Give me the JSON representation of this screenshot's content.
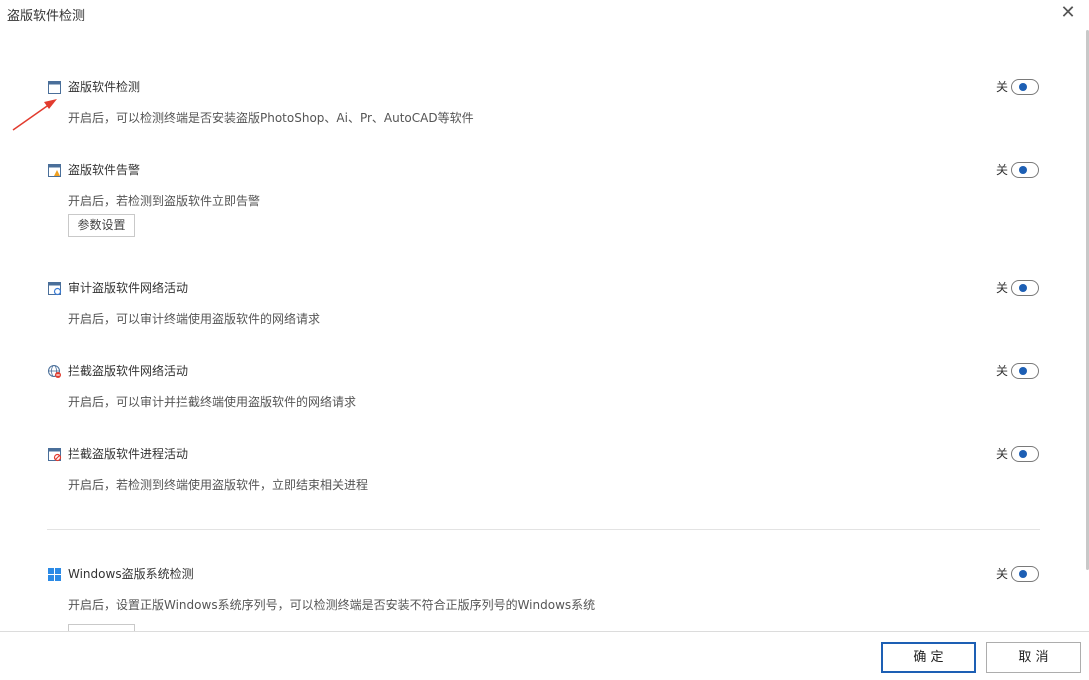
{
  "dialog": {
    "title": "盗版软件检测",
    "close_glyph": "✕"
  },
  "toggle_off_label": "关",
  "sections": [
    {
      "title": "盗版软件检测",
      "desc": "开启后，可以检测终端是否安装盗版PhotoShop、Ai、Pr、AutoCAD等软件",
      "icon": "window-icon",
      "enabled": false
    },
    {
      "title": "盗版软件告警",
      "desc": "开启后，若检测到盗版软件立即告警",
      "icon": "window-alert-icon",
      "enabled": false,
      "button_label": "参数设置"
    },
    {
      "title": "审计盗版软件网络活动",
      "desc": "开启后，可以审计终端使用盗版软件的网络请求",
      "icon": "window-audit-icon",
      "enabled": false
    },
    {
      "title": "拦截盗版软件网络活动",
      "desc": "开启后，可以审计并拦截终端使用盗版软件的网络请求",
      "icon": "globe-block-icon",
      "enabled": false
    },
    {
      "title": "拦截盗版软件进程活动",
      "desc": "开启后，若检测到终端使用盗版软件，立即结束相关进程",
      "icon": "window-block-icon",
      "enabled": false
    },
    {
      "title": "Windows盗版系统检测",
      "desc": "开启后，设置正版Windows系统序列号，可以检测终端是否安装不符合正版序列号的Windows系统",
      "icon": "windows-logo-icon",
      "enabled": false
    }
  ],
  "footer": {
    "ok_label": "确 定",
    "cancel_label": "取 消"
  },
  "colors": {
    "accent": "#1d5fb4",
    "arrow": "#e23b2e"
  }
}
